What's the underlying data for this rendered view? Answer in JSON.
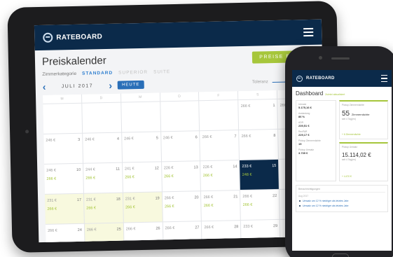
{
  "tablet": {
    "brand": "RATEBOARD",
    "page_title": "Preiskalender",
    "edit_button": "PREISE EDITIE",
    "category_label": "Zimmerkategorie",
    "categories": [
      {
        "label": "STANDARD",
        "active": true
      },
      {
        "label": "SUPERIOR",
        "active": false
      },
      {
        "label": "SUITE",
        "active": false
      }
    ],
    "month": "JULI 2017",
    "today_button": "HEUTE",
    "tolerance_label": "Toleranz",
    "weekdays": [
      "M",
      "D",
      "M",
      "D",
      "F",
      "S",
      "S"
    ],
    "calendar": [
      [
        {
          "blank": true
        },
        {
          "blank": true
        },
        {
          "blank": true
        },
        {
          "blank": true
        },
        {
          "blank": true
        },
        {
          "price": "266 €",
          "day": "1"
        },
        {
          "price": "266 €",
          "day": "2"
        }
      ],
      [
        {
          "price": "246 €",
          "day": "3"
        },
        {
          "price": "246 €",
          "day": "4"
        },
        {
          "price": "246 €",
          "day": "5"
        },
        {
          "price": "246 €",
          "day": "6"
        },
        {
          "price": "266 €",
          "day": "7"
        },
        {
          "price": "266 €",
          "day": "8"
        },
        {
          "price": "",
          "day": ""
        }
      ],
      [
        {
          "price": "246 €",
          "day": "10",
          "sub": "266 €"
        },
        {
          "price": "244 €",
          "day": "11",
          "sub": "266 €"
        },
        {
          "price": "241 €",
          "day": "12",
          "sub": "266 €"
        },
        {
          "price": "226 €",
          "day": "13",
          "sub": "266 €"
        },
        {
          "price": "226 €",
          "day": "14",
          "sub": "266 €"
        },
        {
          "price": "233 €",
          "day": "15",
          "sub": "248 €",
          "selected": true
        },
        {
          "price": "",
          "day": ""
        }
      ],
      [
        {
          "price": "231 €",
          "day": "17",
          "sub": "266 €",
          "highlight": true
        },
        {
          "price": "231 €",
          "day": "18",
          "sub": "266 €",
          "highlight": true
        },
        {
          "price": "231 €",
          "day": "19",
          "sub": "266 €",
          "highlight": true
        },
        {
          "price": "266 €",
          "day": "20",
          "sub": "266 €"
        },
        {
          "price": "266 €",
          "day": "21",
          "sub": "266 €"
        },
        {
          "price": "266 €",
          "day": "22",
          "sub": "266 €"
        },
        {
          "price": "",
          "day": ""
        }
      ],
      [
        {
          "price": "266 €",
          "day": "24"
        },
        {
          "price": "266 €",
          "day": "25",
          "highlight": true
        },
        {
          "price": "266 €",
          "day": "26"
        },
        {
          "price": "266 €",
          "day": "27"
        },
        {
          "price": "266 €",
          "day": "28"
        },
        {
          "price": "233 €",
          "day": "29"
        },
        {
          "price": "",
          "day": ""
        }
      ]
    ]
  },
  "phone": {
    "brand": "RATEBOARD",
    "dashboard_title": "Dashboard",
    "dashboard_sub": "Zuletzt aktualisiert",
    "left_items": [
      {
        "label": "Umsatz",
        "value": "5.175,16 €"
      },
      {
        "label": "Auslastung",
        "value": "86 %"
      },
      {
        "label": "ADR",
        "value": "239,51 €"
      },
      {
        "label": "RevPAR",
        "value": "229,17 €"
      },
      {
        "label": "Pickup Zimmernächte",
        "value": "15"
      },
      {
        "label": "Pickup Umsatz",
        "value": "3.739 €"
      }
    ],
    "card1": {
      "label": "Pickup Zimmernächte",
      "big": "55",
      "unit": "Zimmernächte",
      "note": "seit 4 Tag(en)",
      "foot": "+ 6 Zimmernächte"
    },
    "card2": {
      "label": "Pickup Umsatz",
      "big": "15.114,02 €",
      "note": "seit 4 Tag(en)",
      "foot": "+ 4.470 €"
    },
    "notes_header": "Benachrichtigungen",
    "notes": [
      {
        "date": "Aug 2017",
        "text": "Umsatz um 12 % niedriger als letztes Jahr"
      },
      {
        "date": "",
        "text": "Umsatz um 12 % niedriger als letztes Jahr"
      }
    ]
  }
}
